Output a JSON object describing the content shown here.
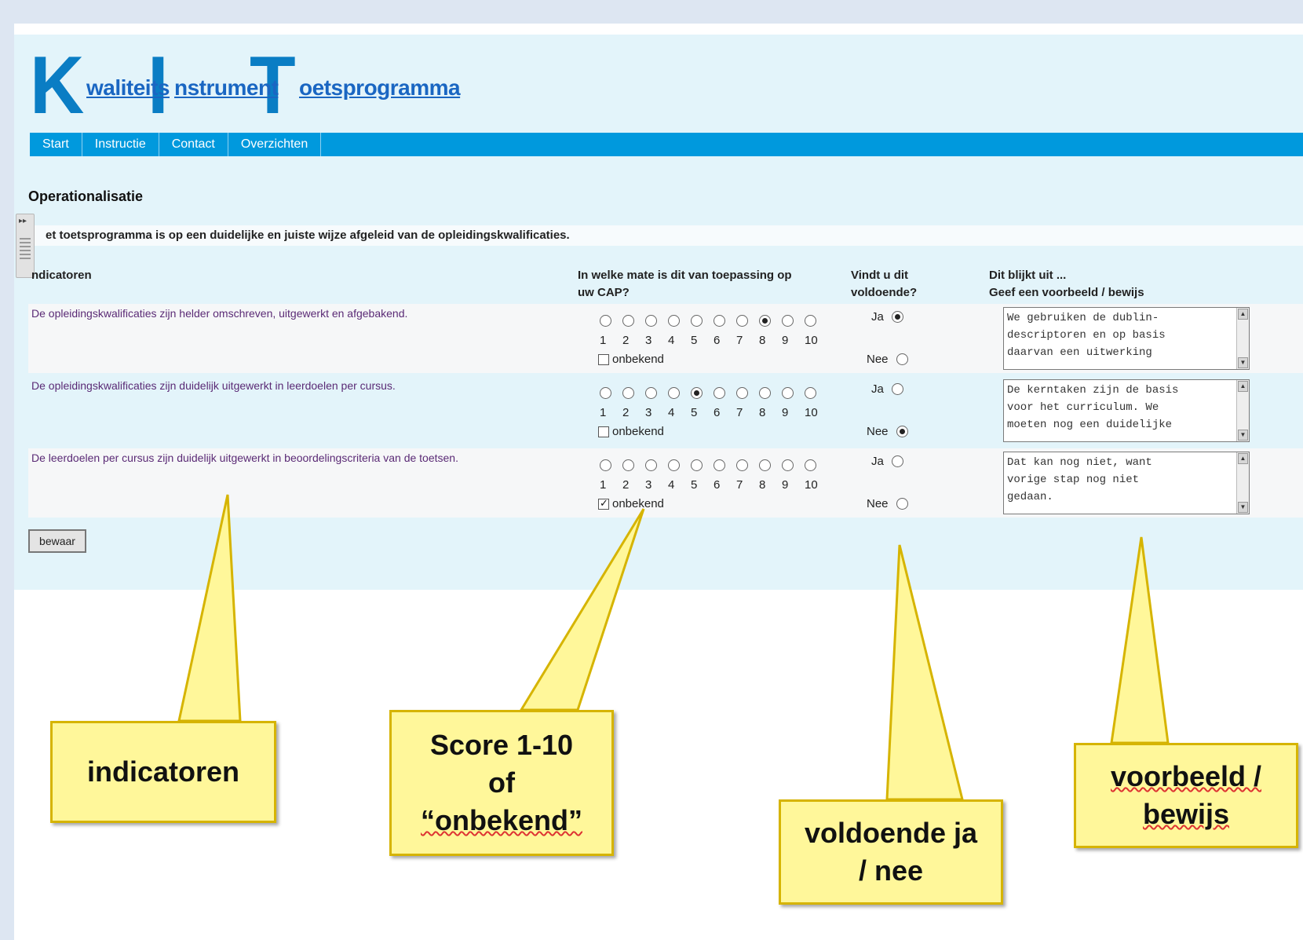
{
  "logo": {
    "big_letters": [
      "K",
      "I",
      "T"
    ],
    "words": [
      "waliteits",
      "nstrument",
      "oetsprogramma"
    ]
  },
  "nav": [
    "Start",
    "Instructie",
    "Contact",
    "Overzichten"
  ],
  "page_title": "Operationalisatie",
  "statement": "et toetsprogramma is op een duidelijke en juiste wijze afgeleid van de opleidingskwalificaties.",
  "columns": {
    "indicator": "ndicatoren",
    "score_line1": "In welke mate is dit van toepassing op",
    "score_line2": "uw CAP?",
    "sufficient_line1": "Vindt u dit",
    "sufficient_line2": "voldoende?",
    "evidence_line1": "Dit blijkt uit ...",
    "evidence_line2": "Geef een voorbeeld / bewijs"
  },
  "scale_numbers": [
    "1",
    "2",
    "3",
    "4",
    "5",
    "6",
    "7",
    "8",
    "9",
    "10"
  ],
  "unknown_label": "onbekend",
  "yes_label": "Ja",
  "no_label": "Nee",
  "rows": [
    {
      "indicator": "De opleidingskwalificaties zijn helder omschreven, uitgewerkt en afgebakend.",
      "selected_score": 8,
      "unknown": false,
      "sufficient": "Ja",
      "evidence": "We gebruiken de dublin-\ndescriptoren en op basis\ndaarvan een uitwerking"
    },
    {
      "indicator": "De opleidingskwalificaties zijn duidelijk uitgewerkt in leerdoelen per cursus.",
      "selected_score": 5,
      "unknown": false,
      "sufficient": "Nee",
      "evidence": "De kerntaken zijn de basis\nvoor het curriculum. We\nmoeten nog een duidelijke"
    },
    {
      "indicator": "De leerdoelen per cursus zijn duidelijk uitgewerkt in beoordelingscriteria van de toetsen.",
      "selected_score": null,
      "unknown": true,
      "sufficient": null,
      "evidence": "Dat kan nog niet, want\nvorige stap nog niet\ngedaan."
    }
  ],
  "save_label": "bewaar",
  "callouts": {
    "indicators": "indicatoren",
    "score_line1": "Score 1-10",
    "score_line2": "of",
    "score_line3": "“onbekend”",
    "sufficient_line1": "voldoende ja",
    "sufficient_line2": "/ nee",
    "evidence_line1": "voorbeeld /",
    "evidence_line2": "bewijs"
  },
  "colors": {
    "accent": "#0099dd",
    "logo": "#0a7dc4",
    "callout_fill": "#fff79a",
    "callout_border": "#d6b400"
  }
}
